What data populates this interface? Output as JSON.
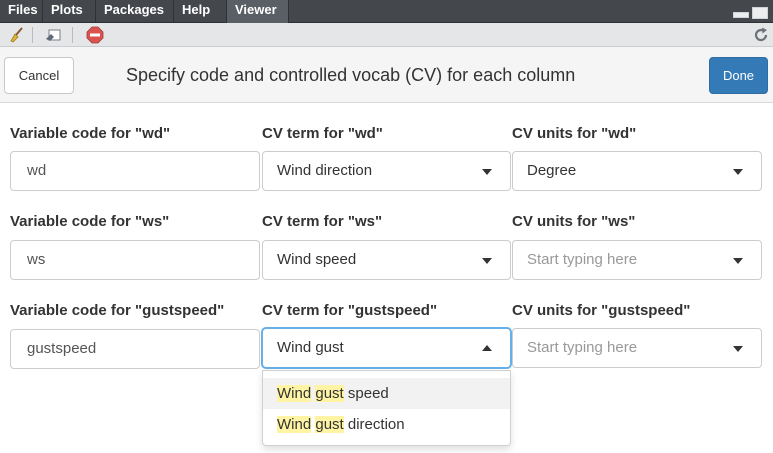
{
  "tabs": [
    "Files",
    "Plots",
    "Packages",
    "Help",
    "Viewer"
  ],
  "active_tab": "Viewer",
  "header": {
    "cancel_label": "Cancel",
    "title": "Specify code and controlled vocab (CV) for each column",
    "done_label": "Done"
  },
  "rows": [
    {
      "code_label": "Variable code for \"wd\"",
      "code_value": "wd",
      "term_label": "CV term for \"wd\"",
      "term_value": "Wind direction",
      "units_label": "CV units for \"wd\"",
      "units_value": "Degree"
    },
    {
      "code_label": "Variable code for \"ws\"",
      "code_value": "ws",
      "term_label": "CV term for \"ws\"",
      "term_value": "Wind speed",
      "units_label": "CV units for \"ws\"",
      "units_placeholder": "Start typing here"
    },
    {
      "code_label": "Variable code for \"gustspeed\"",
      "code_value": "gustspeed",
      "term_label": "CV term for \"gustspeed\"",
      "term_value": "Wind gust",
      "units_label": "CV units for \"gustspeed\"",
      "units_placeholder": "Start typing here"
    }
  ],
  "dropdown": {
    "options": [
      {
        "w1": "Wind",
        "w2": "gust",
        "rest": " speed"
      },
      {
        "w1": "Wind",
        "w2": "gust",
        "rest": " direction"
      }
    ]
  },
  "colors": {
    "accent": "#337ab7",
    "highlight": "#fff4a3",
    "focus": "#66afe9"
  },
  "icons": [
    "broom-icon",
    "clear-viewer-icon",
    "stop-icon",
    "refresh-icon"
  ]
}
